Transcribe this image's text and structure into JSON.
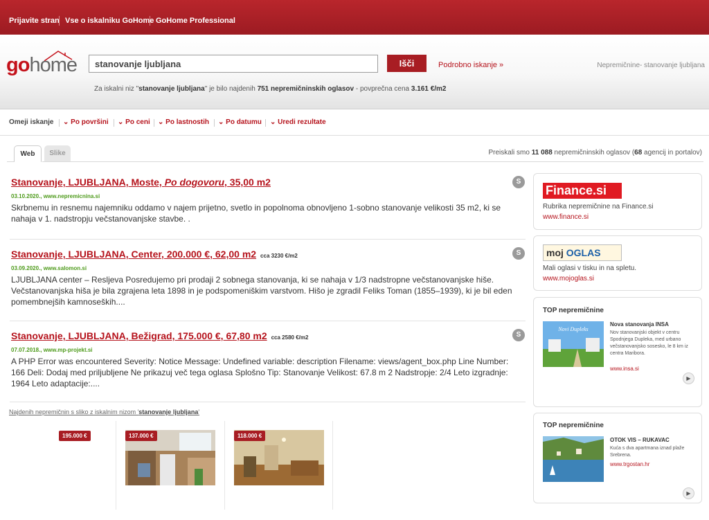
{
  "topnav": [
    "Prijavite stran",
    "Vse o iskalniku GoHome",
    "GoHome Professional"
  ],
  "logo": {
    "go": "go",
    "home": "home"
  },
  "search": {
    "value": "stanovanje ljubljana",
    "button": "Išči",
    "advanced": "Podrobno iskanje »"
  },
  "breadcrumb": "Nepremičnine- stanovanje ljubljana",
  "summary": {
    "prefix": "Za iskalni niz \"",
    "query": "stanovanje ljubljana",
    "mid": "\" je bilo najdenih ",
    "count": "751 nepremičninskih oglasov",
    "mid2": " - povprečna cena ",
    "price": "3.161 €/m2"
  },
  "filters": [
    "Omeji iskanje",
    "Po površini",
    "Po ceni",
    "Po lastnostih",
    "Po datumu",
    "Uredi rezultate"
  ],
  "tabs": [
    "Web",
    "Slike"
  ],
  "preiskali": {
    "prefix": "Preiskali smo ",
    "count": "11 088",
    "mid": " nepremičninskih oglasov (",
    "agencies": "68",
    "suffix": " agencij in portalov)"
  },
  "results": [
    {
      "title": "Stanovanje, LJUBLJANA, Moste, ",
      "title_italic": "Po dogovoru",
      "title_end": ", 35,00 m2",
      "per_m2": "",
      "source": "03.10.2020., www.nepremicnina.si",
      "desc": "Skrbnemu in resnemu najemniku oddamo v najem prijetno, svetlo in popolnoma obnovljeno 1-sobno stanovanje velikosti 35 m2, ki se nahaja v 1. nadstropju večstanovanjske stavbe. .",
      "icon": "S"
    },
    {
      "title": "Stanovanje, LJUBLJANA, Center, 200.000 €, 62,00 m2",
      "title_italic": "",
      "title_end": "",
      "per_m2": "cca 3230 €/m2",
      "source": "03.09.2020., www.salomon.si",
      "desc": "LJUBLJANA center – Resljeva Posredujemo pri prodaji 2 sobnega stanovanja, ki se nahaja v 1/3 nadstropne večstanovanjske hiše. Večstanovanjska hiša je bila zgrajena leta 1898 in je podspomeniškim varstvom. Hišo je zgradil Feliks Toman (1855–1939), ki je bil eden pomembnejših kamnoseških....",
      "icon": "S"
    },
    {
      "title": "Stanovanje, LJUBLJANA, Bežigrad, 175.000 €, 67,80 m2",
      "title_italic": "",
      "title_end": "",
      "per_m2": "cca 2580 €/m2",
      "source": "07.07.2018., www.mp-projekt.si",
      "desc": "A PHP Error was encountered Severity: Notice Message: Undefined variable: description Filename: views/agent_box.php Line Number: 166 Deli: Dodaj med priljubljene Ne prikazuj več tega oglasa Splošno Tip: Stanovanje Velikost: 67.8 m 2 Nadstropje: 2/4 Leto izgradnje: 1964 Leto adaptacije:....",
      "icon": "S"
    }
  ],
  "images_note": {
    "prefix": "Najdenih nepremičnin s sliko z iskalnim nizom '",
    "query": "stanovanje ljubljana",
    "suffix": "'"
  },
  "thumbs": [
    {
      "price": "195.000 €"
    },
    {
      "price": "137.000 €"
    },
    {
      "price": "118.000 €"
    }
  ],
  "sidebar": {
    "finance": {
      "logo": "Finance.si",
      "desc": "Rubrika nepremičnine na Finance.si",
      "url": "www.finance.si"
    },
    "mojoglas": {
      "logo_a": "moj",
      "logo_b": "OGLAS",
      "desc": "Mali oglasi v tisku in na spletu.",
      "url": "www.mojoglas.si"
    },
    "top1": {
      "title": "TOP nepremičnine",
      "img_text": "Novi Dupleks",
      "ad_title": "Nova stanovanja INSA",
      "ad_desc": "Nov stanovanjski objekt v centru Spodnjega Dupleka, med urbano večstanovanjsko sosesko, le 8 km iz centra Maribora.",
      "url": "www.insa.si"
    },
    "top2": {
      "title": "TOP nepremičnine",
      "ad_title": "OTOK VIS – RUKAVAC",
      "ad_desc": "Kuća s dva apartmana iznad plaže Srebrena.",
      "url": "www.trgostan.hr"
    }
  },
  "colors": {
    "brand": "#b5121b",
    "header": "#a81d23",
    "source": "#4d9a1a"
  }
}
